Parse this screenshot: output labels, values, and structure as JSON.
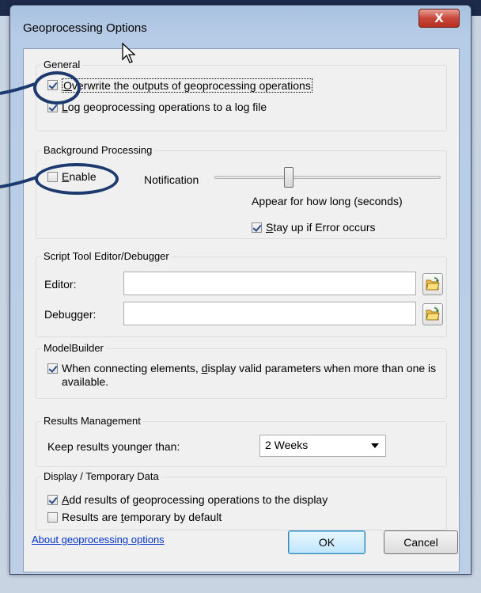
{
  "window": {
    "title": "Geoprocessing Options",
    "close_label": "X"
  },
  "general": {
    "title": "General",
    "overwrite": {
      "pre": "",
      "underlined": "O",
      "post": "verwrite the outputs of geoprocessing operations",
      "checked": true
    },
    "log": {
      "pre": "",
      "underlined": "L",
      "post": "og geoprocessing operations to a log file",
      "checked": true
    }
  },
  "background": {
    "title": "Background Processing",
    "enable": {
      "pre": "",
      "underlined": "E",
      "post": "nable",
      "checked": false
    },
    "notification_label": "Notification",
    "notification_level": 0.33,
    "appear_label": "Appear for how long (seconds)",
    "stay_up": {
      "pre": "",
      "underlined": "S",
      "post": "tay up if Error occurs",
      "checked": true
    }
  },
  "script": {
    "title": "Script Tool Editor/Debugger",
    "editor_label": "Editor:",
    "editor_value": "",
    "debugger_label": "Debugger:",
    "debugger_value": ""
  },
  "modelbuilder": {
    "title": "ModelBuilder",
    "valid_params": {
      "line1_pre": "When connecting elements, ",
      "underlined": "d",
      "line1_post": "isplay valid parameters when more than one is",
      "line2": "available.",
      "checked": true
    }
  },
  "results": {
    "title": "Results Management",
    "keep_label": "Keep results younger than:",
    "keep_value": "2 Weeks"
  },
  "display": {
    "title": "Display / Temporary Data",
    "add_results": {
      "pre": "",
      "underlined": "A",
      "post": "dd results of geoprocessing operations to the display",
      "checked": true
    },
    "temporary": {
      "pre": "Results are ",
      "underlined": "t",
      "post": "emporary by default",
      "checked": false
    }
  },
  "footer": {
    "about_link": "About geoprocessing options",
    "ok_label": "OK",
    "cancel_label": "Cancel"
  },
  "colors": {
    "highlight_oval": "#1c3a6e",
    "link": "#0033cc",
    "close_button": "#c9473a"
  }
}
